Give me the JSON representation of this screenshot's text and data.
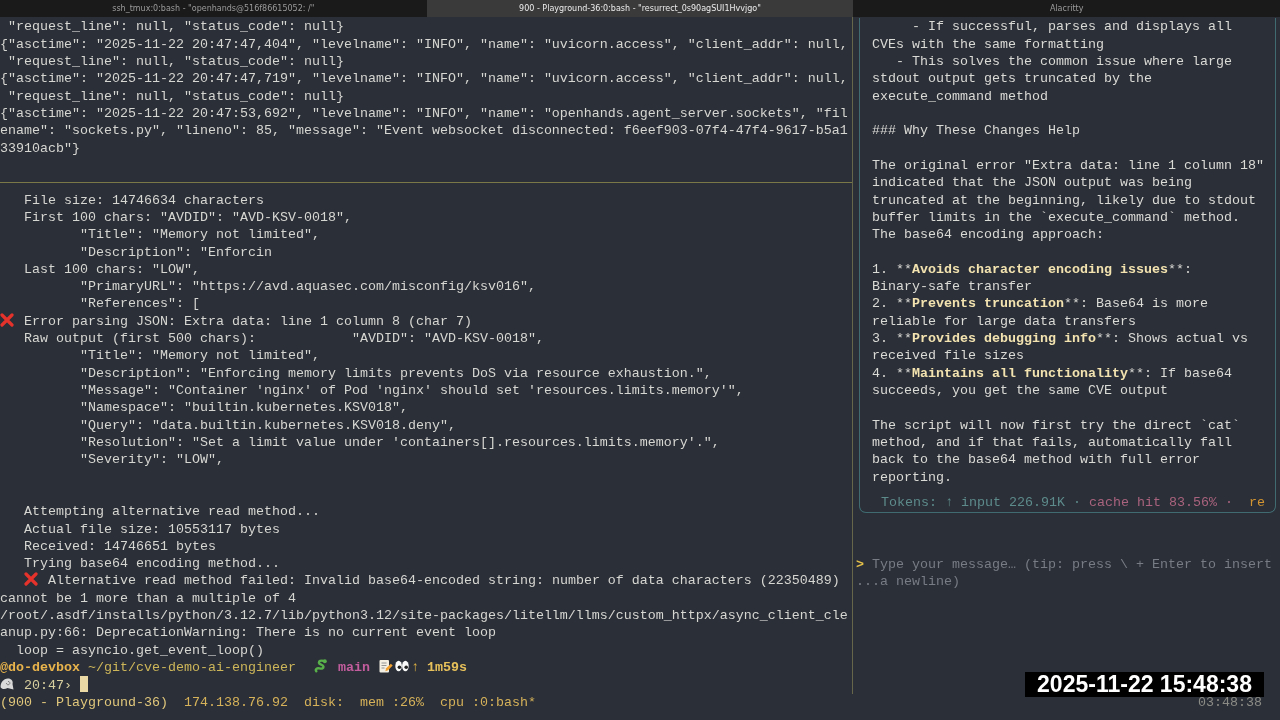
{
  "window": {
    "tabs": [
      {
        "label": "ssh_tmux:0:bash - \"openhands@516f86615052: /\"",
        "selected": false
      },
      {
        "label": "900 - Playground-36:0:bash - \"resurrect_0s90agSUI1Hvvjgo\"",
        "selected": true
      },
      {
        "label": "Alacritty",
        "selected": false
      }
    ]
  },
  "log_pane": {
    "lines": [
      " \"request_line\": null, \"status_code\": null}",
      "{\"asctime\": \"2025-11-22 20:47:47,404\", \"levelname\": \"INFO\", \"name\": \"uvicorn.access\", \"client_addr\": null,",
      " \"request_line\": null, \"status_code\": null}",
      "{\"asctime\": \"2025-11-22 20:47:47,719\", \"levelname\": \"INFO\", \"name\": \"uvicorn.access\", \"client_addr\": null,",
      " \"request_line\": null, \"status_code\": null}",
      "{\"asctime\": \"2025-11-22 20:47:53,692\", \"levelname\": \"INFO\", \"name\": \"openhands.agent_server.sockets\", \"fil",
      "ename\": \"sockets.py\", \"lineno\": 85, \"message\": \"Event websocket disconnected: f6eef903-07f4-47f4-9617-b5a1",
      "33910acb\"}"
    ]
  },
  "shell_pane": {
    "lines": [
      {
        "kind": "output",
        "text": "   File size: 14746634 characters"
      },
      {
        "kind": "output",
        "text": "   First 100 chars: \"AVDID\": \"AVD-KSV-0018\","
      },
      {
        "kind": "output",
        "text": "          \"Title\": \"Memory not limited\","
      },
      {
        "kind": "output",
        "text": "          \"Description\": \"Enforcin"
      },
      {
        "kind": "output",
        "text": "   Last 100 chars: \"LOW\","
      },
      {
        "kind": "output",
        "text": "          \"PrimaryURL\": \"https://avd.aquasec.com/misconfig/ksv016\","
      },
      {
        "kind": "output",
        "text": "          \"References\": ["
      },
      {
        "kind": "error",
        "text": "Error parsing JSON: Extra data: line 1 column 8 (char 7)"
      },
      {
        "kind": "output",
        "text": "   Raw output (first 500 chars):            \"AVDID\": \"AVD-KSV-0018\","
      },
      {
        "kind": "output",
        "text": "          \"Title\": \"Memory not limited\","
      },
      {
        "kind": "output",
        "text": "          \"Description\": \"Enforcing memory limits prevents DoS via resource exhaustion.\","
      },
      {
        "kind": "output",
        "text": "          \"Message\": \"Container 'nginx' of Pod 'nginx' should set 'resources.limits.memory'\","
      },
      {
        "kind": "output",
        "text": "          \"Namespace\": \"builtin.kubernetes.KSV018\","
      },
      {
        "kind": "output",
        "text": "          \"Query\": \"data.builtin.kubernetes.KSV018.deny\","
      },
      {
        "kind": "output",
        "text": "          \"Resolution\": \"Set a limit value under 'containers[].resources.limits.memory'.\","
      },
      {
        "kind": "output",
        "text": "          \"Severity\": \"LOW\","
      },
      {
        "kind": "blank"
      },
      {
        "kind": "blank"
      },
      {
        "kind": "output",
        "text": "   Attempting alternative read method..."
      },
      {
        "kind": "output",
        "text": "   Actual file size: 10553117 bytes"
      },
      {
        "kind": "output",
        "text": "   Received: 14746651 bytes"
      },
      {
        "kind": "output",
        "text": "   Trying base64 encoding method..."
      },
      {
        "kind": "error",
        "text": "   Alternative read method failed: Invalid base64-encoded string: number of data characters (22350489)"
      },
      {
        "kind": "output",
        "text": "cannot be 1 more than a multiple of 4"
      },
      {
        "kind": "output",
        "text": "/root/.asdf/installs/python/3.12.7/lib/python3.12/site-packages/litellm/llms/custom_httpx/async_client_cle"
      },
      {
        "kind": "output",
        "text": "anup.py:66: DeprecationWarning: There is no current event loop"
      },
      {
        "kind": "output",
        "text": "  loop = asyncio.get_event_loop()"
      }
    ],
    "prompt": {
      "host": "@do-devbox",
      "path": "~/git/cve-demo-ai-engineer",
      "branch": "main",
      "ahead": "↑",
      "duration": "1m59s"
    },
    "input_line": {
      "time": "20:47",
      "symbol": "›",
      "cursor": true
    }
  },
  "chat_pane": {
    "lines": [
      {
        "kind": "text",
        "text": "     - If successful, parses and displays all"
      },
      {
        "kind": "text",
        "text": "CVEs with the same formatting"
      },
      {
        "kind": "text",
        "text": "   - This solves the common issue where large"
      },
      {
        "kind": "text",
        "text": "stdout output gets truncated by the"
      },
      {
        "kind": "text",
        "text": "execute_command method"
      },
      {
        "kind": "blank"
      },
      {
        "kind": "text",
        "text": "### Why These Changes Help"
      },
      {
        "kind": "blank"
      },
      {
        "kind": "text",
        "text": "The original error \"Extra data: line 1 column 18\""
      },
      {
        "kind": "text",
        "text": "indicated that the JSON output was being"
      },
      {
        "kind": "text",
        "text": "truncated at the beginning, likely due to stdout"
      },
      {
        "kind": "text",
        "text": "buffer limits in the `execute_command` method."
      },
      {
        "kind": "text",
        "text": "The base64 encoding approach:"
      },
      {
        "kind": "blank"
      },
      {
        "kind": "styled",
        "parts": [
          {
            "text": "1. **",
            "bold": false
          },
          {
            "text": "Avoids character encoding issues",
            "bold": true
          },
          {
            "text": "**:",
            "bold": false
          }
        ]
      },
      {
        "kind": "text",
        "text": "Binary-safe transfer"
      },
      {
        "kind": "styled",
        "parts": [
          {
            "text": "2. **",
            "bold": false
          },
          {
            "text": "Prevents truncation",
            "bold": true
          },
          {
            "text": "**: Base64 is more",
            "bold": false
          }
        ]
      },
      {
        "kind": "text",
        "text": "reliable for large data transfers"
      },
      {
        "kind": "styled",
        "parts": [
          {
            "text": "3. **",
            "bold": false
          },
          {
            "text": "Provides debugging info",
            "bold": true
          },
          {
            "text": "**: Shows actual vs",
            "bold": false
          }
        ]
      },
      {
        "kind": "text",
        "text": "received file sizes"
      },
      {
        "kind": "styled",
        "parts": [
          {
            "text": "4. **",
            "bold": false
          },
          {
            "text": "Maintains all functionality",
            "bold": true
          },
          {
            "text": "**: If base64",
            "bold": false
          }
        ]
      },
      {
        "kind": "text",
        "text": "succeeds, you get the same CVE output"
      },
      {
        "kind": "blank"
      },
      {
        "kind": "text",
        "text": "The script will now first try the direct `cat`"
      },
      {
        "kind": "text",
        "text": "method, and if that fails, automatically fall"
      },
      {
        "kind": "text",
        "text": "back to the base64 method with full error"
      },
      {
        "kind": "text",
        "text": "reporting."
      }
    ],
    "token_usage": [
      {
        "kind": "input",
        "text": "Tokens: ↑ input 226.91K ·"
      },
      {
        "kind": "cache",
        "text": "cache hit 83.56% ·"
      },
      {
        "kind": "overflow",
        "text": "re"
      }
    ],
    "composer": {
      "prompt": ">",
      "placeholder": "Type your message… (tip: press \\ + Enter to insert ...a newline)"
    }
  },
  "status_bar": {
    "items": [
      "(900 - Playground-36)",
      "174.138.76.92",
      "disk:",
      "mem :26%",
      "cpu :0:bash*"
    ],
    "clock": "03:48:38"
  },
  "recording_timestamp": "2025-11-22 15:48:38"
}
